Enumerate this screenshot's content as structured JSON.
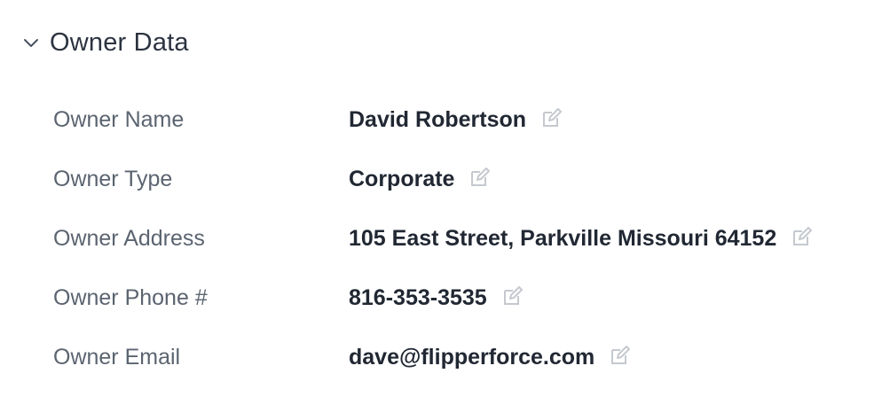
{
  "section": {
    "title": "Owner Data",
    "toggle_icon": "chevron-down-icon"
  },
  "fields": [
    {
      "label": "Owner Name",
      "value": "David Robertson",
      "icon": "edit-icon"
    },
    {
      "label": "Owner Type",
      "value": "Corporate",
      "icon": "edit-icon"
    },
    {
      "label": "Owner Address",
      "value": "105 East Street, Parkville Missouri 64152",
      "icon": "edit-icon"
    },
    {
      "label": "Owner Phone #",
      "value": "816-353-3535",
      "icon": "edit-icon"
    },
    {
      "label": "Owner Email",
      "value": "dave@flipperforce.com",
      "icon": "edit-icon"
    }
  ],
  "colors": {
    "label": "#5b6470",
    "value": "#212833",
    "icon": "#c5c9cf"
  }
}
